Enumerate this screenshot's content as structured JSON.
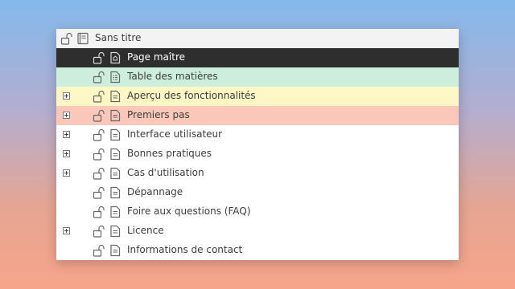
{
  "colors": {
    "selected_bg": "#2e2e2e",
    "green_bg": "#cdeedd",
    "yellow_bg": "#fdf7c5",
    "red_bg": "#fbc7b8"
  },
  "tree": {
    "root": {
      "label": "Sans titre",
      "icon": "book-icon",
      "lock_icon": "unlocked-padlock-icon"
    },
    "items": [
      {
        "label": "Page maître",
        "icon": "master-page-icon",
        "expandable": false,
        "highlight": "selected"
      },
      {
        "label": "Table des matières",
        "icon": "toc-page-icon",
        "expandable": false,
        "highlight": "green"
      },
      {
        "label": "Aperçu des fonctionnalités",
        "icon": "page-icon",
        "expandable": true,
        "highlight": "yellow"
      },
      {
        "label": "Premiers pas",
        "icon": "page-icon",
        "expandable": true,
        "highlight": "red"
      },
      {
        "label": "Interface utilisateur",
        "icon": "page-icon",
        "expandable": true,
        "highlight": "none"
      },
      {
        "label": "Bonnes pratiques",
        "icon": "page-icon",
        "expandable": true,
        "highlight": "none"
      },
      {
        "label": "Cas d'utilisation",
        "icon": "page-icon",
        "expandable": true,
        "highlight": "none"
      },
      {
        "label": "Dépannage",
        "icon": "page-icon",
        "expandable": false,
        "highlight": "none"
      },
      {
        "label": "Foire aux questions (FAQ)",
        "icon": "page-icon",
        "expandable": false,
        "highlight": "none"
      },
      {
        "label": "Licence",
        "icon": "page-icon",
        "expandable": true,
        "highlight": "none"
      },
      {
        "label": "Informations de contact",
        "icon": "page-icon",
        "expandable": false,
        "highlight": "none"
      }
    ]
  }
}
